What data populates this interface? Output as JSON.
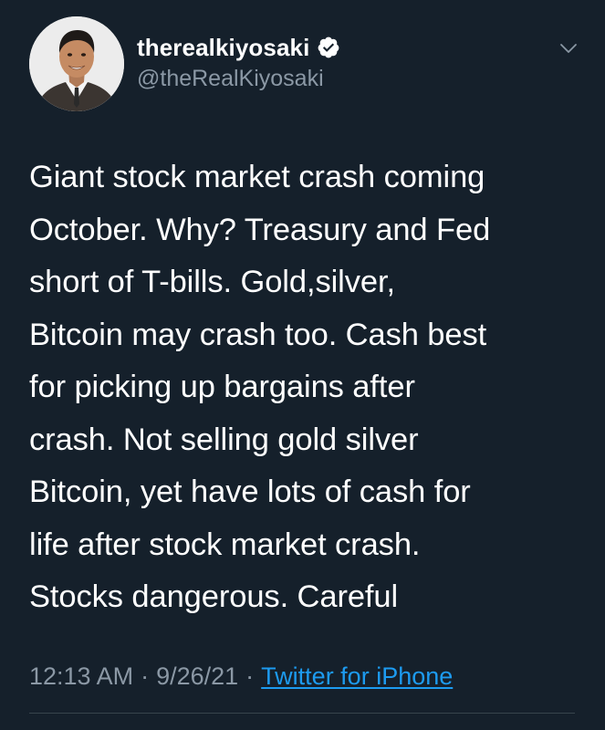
{
  "author": {
    "display_name": "therealkiyosaki",
    "handle": "@theRealKiyosaki",
    "verified": true
  },
  "tweet": {
    "text": "Giant stock market crash coming\nOctober. Why?  Treasury and Fed\nshort of T-bills. Gold,silver,\nBitcoin may crash too. Cash best\nfor picking up bargains after\ncrash. Not selling gold silver\nBitcoin, yet have lots of cash for\nlife after stock market crash.\nStocks dangerous. Careful",
    "time": "12:13 AM",
    "date": "9/26/21",
    "separator": "·",
    "source": "Twitter for iPhone"
  },
  "icons": {
    "verified": "verified-badge-icon",
    "more": "chevron-down-icon"
  },
  "colors": {
    "background": "#15202b",
    "text": "#ffffff",
    "secondary_text": "#8b98a5",
    "link": "#1d9bf0",
    "divider": "#38444d"
  }
}
